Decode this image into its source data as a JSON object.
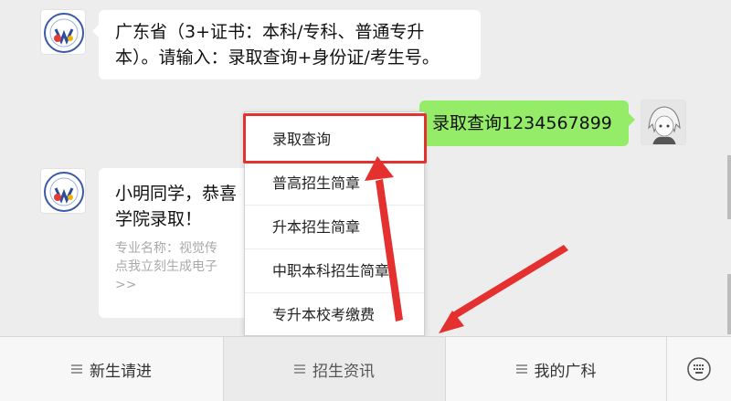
{
  "messages": [
    {
      "id": "bot1",
      "lines": [
        "广东省（3+证书：本科/专科、普通专升",
        "本）。请输入：录取查询+身份证/考生号。"
      ]
    },
    {
      "id": "user1",
      "text": "录取查询1234567899"
    },
    {
      "id": "bot2",
      "lines": [
        "小明同学，恭喜",
        "学院录取！"
      ],
      "muted_lines": [
        "专业名称：视觉传",
        "点我立刻生成电子",
        ">>"
      ]
    }
  ],
  "popup_menu": {
    "items": [
      "录取查询",
      "普高招生简章",
      "升本招生简章",
      "中职本科招生简章",
      "专升本校考缴费"
    ]
  },
  "bottom_menu": {
    "tabs": [
      "新生请进",
      "招生资讯",
      "我的广科"
    ],
    "active_tab": "招生资讯",
    "keyboard_icon": "keyboard-icon"
  },
  "colors": {
    "accent_red": "#e53030",
    "user_bubble": "#95ec69",
    "background": "#ededed"
  }
}
